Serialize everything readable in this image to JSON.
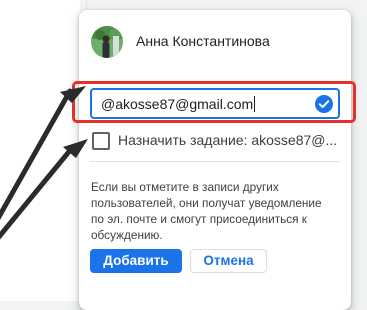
{
  "user": {
    "name": "Анна Константинова"
  },
  "email_field": {
    "value": "@akosse87@gmail.com"
  },
  "assign_task": {
    "label": "Назначить задание: akosse87@...",
    "checked": false
  },
  "info": {
    "text": "Если вы отметите в записи других пользователей, они получат уведомление по эл. почте и смогут присоединиться к обсуждению."
  },
  "buttons": {
    "add_label": "Добавить",
    "cancel_label": "Отмена"
  },
  "colors": {
    "accent": "#1a73e8",
    "highlight": "#e8302a",
    "arrow": "#2b2b2b"
  },
  "icons": {
    "verified": "check-circle-icon",
    "avatar": "user-photo"
  }
}
